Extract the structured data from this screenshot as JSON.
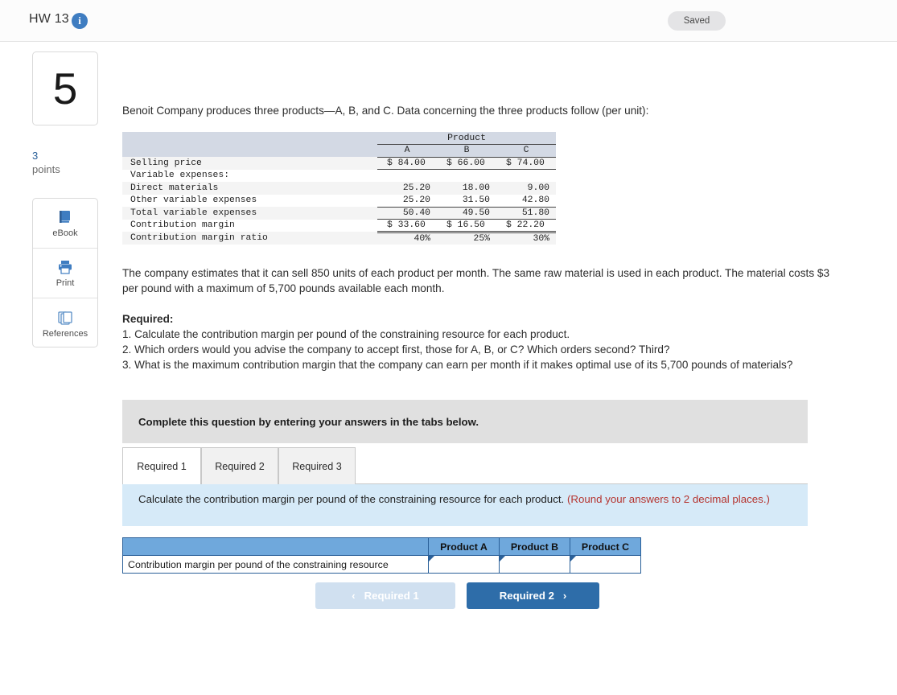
{
  "topbar": {
    "title": "HW 13",
    "info_icon": "info-icon",
    "saved_label": "Saved"
  },
  "sidebar": {
    "question_number": "5",
    "points_value": "3",
    "points_label": "points",
    "tools": [
      {
        "label": "eBook",
        "icon": "ebook-icon"
      },
      {
        "label": "Print",
        "icon": "print-icon"
      },
      {
        "label": "References",
        "icon": "references-icon"
      }
    ]
  },
  "question": {
    "intro": "Benoit Company produces three products—A, B, and C. Data concerning the three products follow (per unit):",
    "paragraph_2": "The company estimates that it can sell 850 units of each product per month. The same raw material is used in each product. The material costs $3 per pound with a maximum of 5,700 pounds available each month.",
    "required_heading": "Required:",
    "required_items": [
      "1. Calculate the contribution margin per pound of the constraining resource for each product.",
      "2. Which orders would you advise the company to accept first, those for A, B, or C? Which orders second? Third?",
      "3. What is the maximum contribution margin that the company can earn per month if it makes optimal use of its 5,700 pounds of materials?"
    ]
  },
  "data_table": {
    "group_header": "Product",
    "columns": [
      "A",
      "B",
      "C"
    ],
    "rows": [
      {
        "label": "Selling price",
        "values": [
          "$  84.00",
          "$  66.00",
          "$  74.00"
        ],
        "dollar": true,
        "shade": true,
        "rule": "under"
      },
      {
        "label": "Variable expenses:",
        "values": [
          "",
          "",
          ""
        ],
        "dollar": false,
        "shade": false,
        "rule": "none"
      },
      {
        "label": "  Direct materials",
        "values": [
          "25.20",
          "18.00",
          "9.00"
        ],
        "dollar": false,
        "shade": true,
        "rule": "none"
      },
      {
        "label": "  Other variable expenses",
        "values": [
          "25.20",
          "31.50",
          "42.80"
        ],
        "dollar": false,
        "shade": false,
        "rule": "under"
      },
      {
        "label": "Total variable expenses",
        "values": [
          "50.40",
          "49.50",
          "51.80"
        ],
        "dollar": false,
        "shade": true,
        "rule": "under"
      },
      {
        "label": "Contribution margin",
        "values": [
          "$  33.60",
          "$  16.50",
          "$  22.20"
        ],
        "dollar": true,
        "shade": false,
        "rule": "double"
      },
      {
        "label": "Contribution margin ratio",
        "values": [
          "40%",
          "25%",
          "30%"
        ],
        "dollar": false,
        "shade": true,
        "rule": "none"
      }
    ]
  },
  "callout": {
    "text": "Complete this question by entering your answers in the tabs below."
  },
  "tabs": [
    {
      "label": "Required 1",
      "active": true
    },
    {
      "label": "Required 2",
      "active": false
    },
    {
      "label": "Required 3",
      "active": false
    }
  ],
  "blue_band": {
    "text": "Calculate the contribution margin per pound of the constraining resource for each product. ",
    "note": "(Round your answers to 2 decimal places.)"
  },
  "answer_table": {
    "corner_label": "",
    "columns": [
      "Product A",
      "Product B",
      "Product C"
    ],
    "row_label": "Contribution margin per pound of the constraining resource",
    "values": [
      "",
      "",
      ""
    ]
  },
  "nav": {
    "prev_label": "Required 1",
    "prev_chevron": "‹",
    "next_label": "Required 2",
    "next_chevron": "›"
  },
  "colors": {
    "accent_blue": "#2e6da9",
    "table_header": "#d3d9e4",
    "answer_header": "#6fa8dc",
    "blue_band": "#d6eaf8",
    "callout_grey": "#e0e0e0",
    "note_red": "#b5342f"
  }
}
